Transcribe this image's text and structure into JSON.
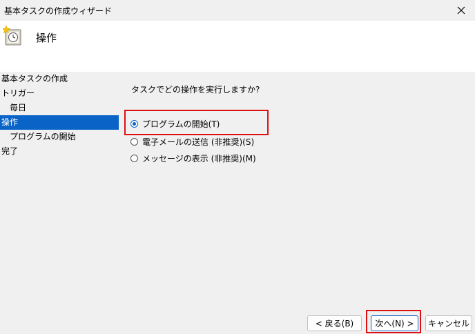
{
  "window": {
    "title": "基本タスクの作成ウィザード"
  },
  "header": {
    "title": "操作"
  },
  "nav": {
    "items": [
      {
        "label": "基本タスクの作成"
      },
      {
        "label": "トリガー"
      },
      {
        "label": "毎日"
      },
      {
        "label": "操作"
      },
      {
        "label": "プログラムの開始"
      },
      {
        "label": "完了"
      }
    ]
  },
  "main": {
    "question": "タスクでどの操作を実行しますか?",
    "options": [
      {
        "label": "プログラムの開始(T)",
        "selected": true
      },
      {
        "label": "電子メールの送信 (非推奨)(S)",
        "selected": false
      },
      {
        "label": "メッセージの表示 (非推奨)(M)",
        "selected": false
      }
    ]
  },
  "buttons": {
    "back": "< 戻る(B)",
    "next": "次へ(N) >",
    "cancel": "キャンセル"
  },
  "colors": {
    "highlight": "#e01010",
    "selection": "#0a64c8"
  }
}
